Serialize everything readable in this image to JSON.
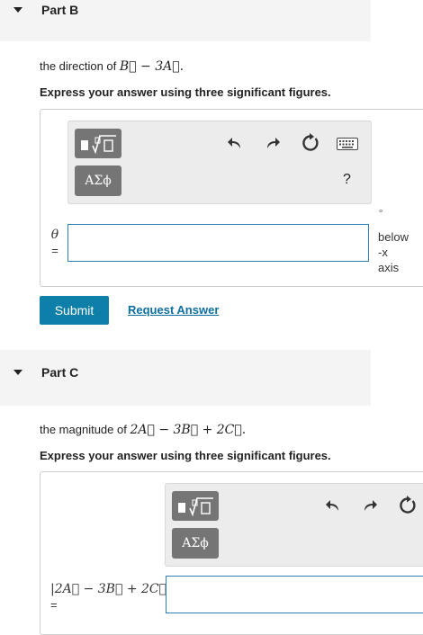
{
  "part_b": {
    "title": "Part B",
    "question_prefix": "the direction of ",
    "question_math": "B⃗ − 3A⃗.",
    "instruction": "Express your answer using three significant figures.",
    "toolbar": {
      "templates_icon": "fraction-root-template-icon",
      "greek_label": "ΑΣϕ",
      "undo_icon": "undo-icon",
      "redo_icon": "redo-icon",
      "reset_icon": "reset-icon",
      "keyboard_icon": "keyboard-icon",
      "help_label": "?"
    },
    "variable": "θ",
    "equals": "=",
    "input_value": "",
    "unit_degree": "∘",
    "unit_text": [
      "below",
      "-x",
      "axis"
    ],
    "submit_label": "Submit",
    "request_label": "Request Answer"
  },
  "part_c": {
    "title": "Part C",
    "question_prefix": "the magnitude of ",
    "question_math": "2A⃗ − 3B⃗ + 2C⃗.",
    "instruction": "Express your answer using three significant figures.",
    "toolbar": {
      "templates_icon": "fraction-root-template-icon",
      "greek_label": "ΑΣϕ",
      "undo_icon": "undo-icon",
      "redo_icon": "redo-icon",
      "reset_icon": "reset-icon"
    },
    "variable": "|2A⃗ − 3B⃗ + 2C⃗|",
    "equals": "=",
    "input_value": ""
  }
}
